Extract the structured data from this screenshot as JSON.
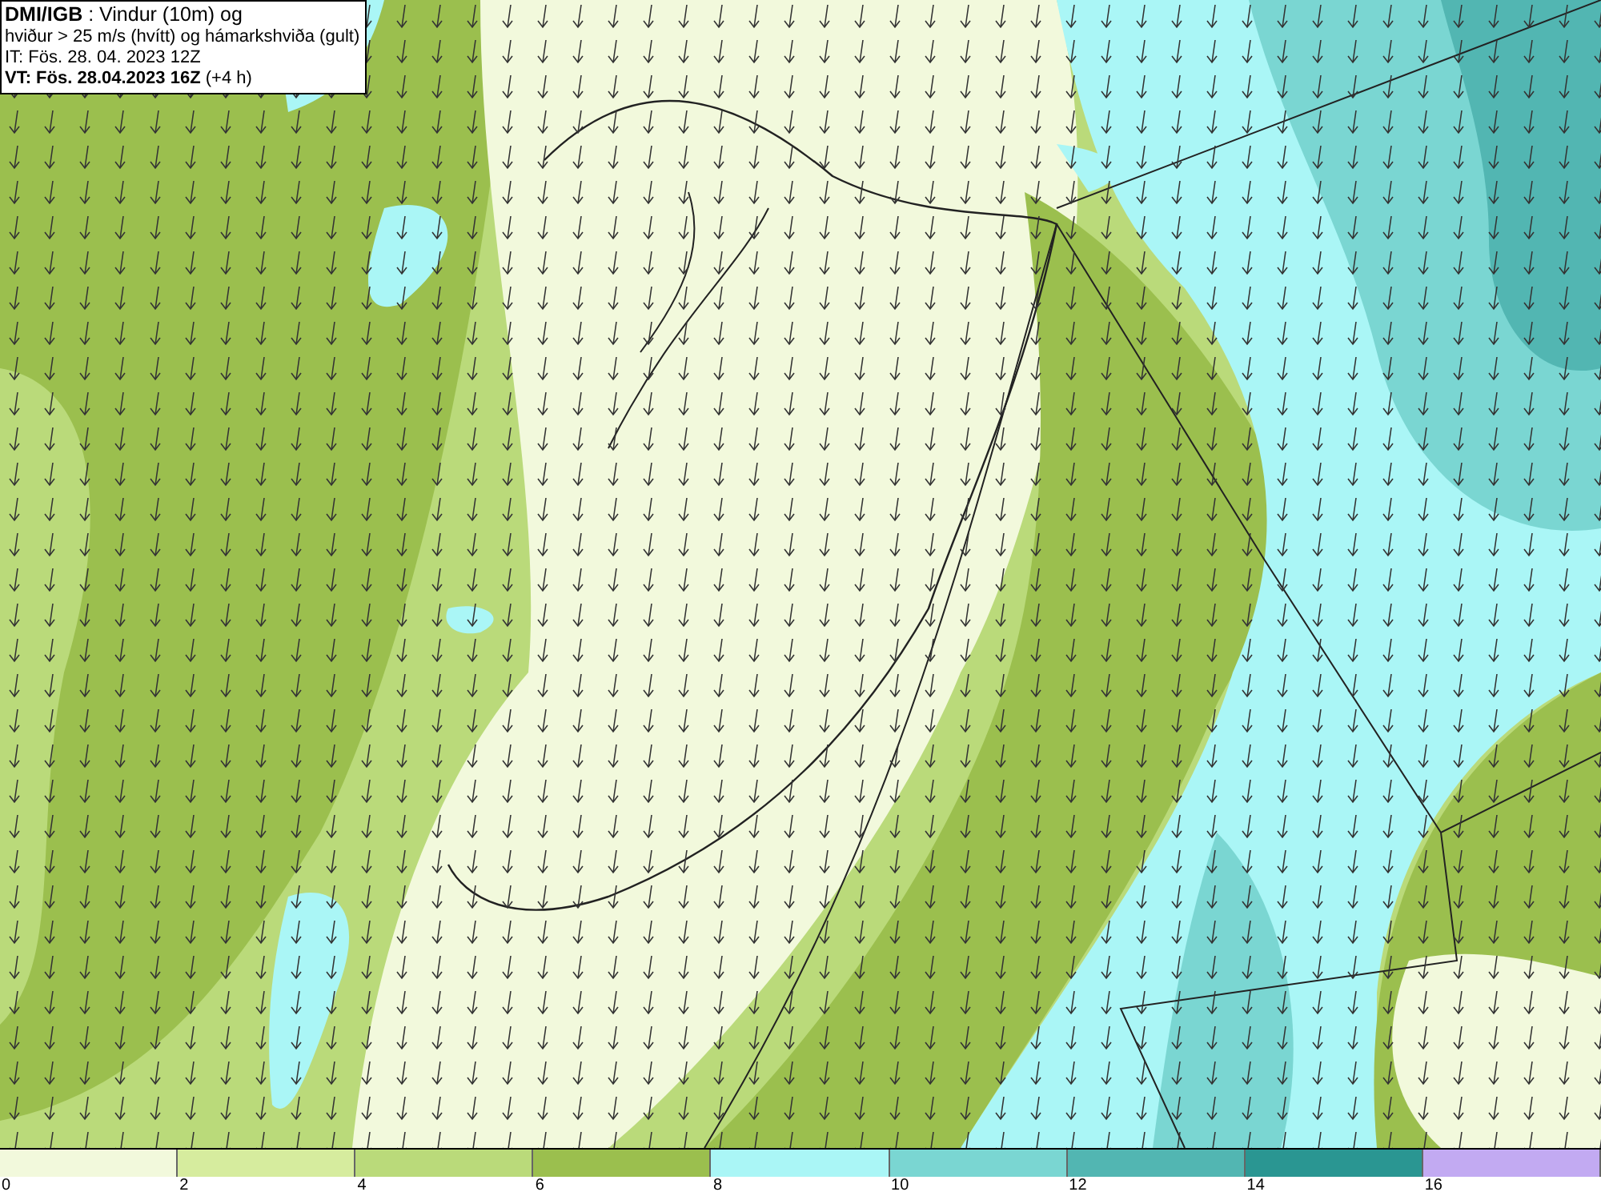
{
  "header": {
    "lines": [
      "**DMI/IGB** : Vindur (10m) og",
      "hviður > 25 m/s (hvítt) og hámarkshviða (gult)",
      "IT: Fös. 28. 04. 2023 12Z",
      "**VT: Fös. 28.04.2023 16Z** (+4 h)"
    ]
  },
  "legend": {
    "bins": [
      {
        "label": "0",
        "color": "#f2f9dc"
      },
      {
        "label": "2",
        "color": "#d6ec9e"
      },
      {
        "label": "4",
        "color": "#bada7a"
      },
      {
        "label": "6",
        "color": "#9bbf4e"
      },
      {
        "label": "8",
        "color": "#aaf6f6"
      },
      {
        "label": "10",
        "color": "#7ad6d2"
      },
      {
        "label": "12",
        "color": "#52b6b2"
      },
      {
        "label": "14",
        "color": "#2a9692"
      },
      {
        "label": "16",
        "color": "#c2aaf2"
      }
    ]
  }
}
